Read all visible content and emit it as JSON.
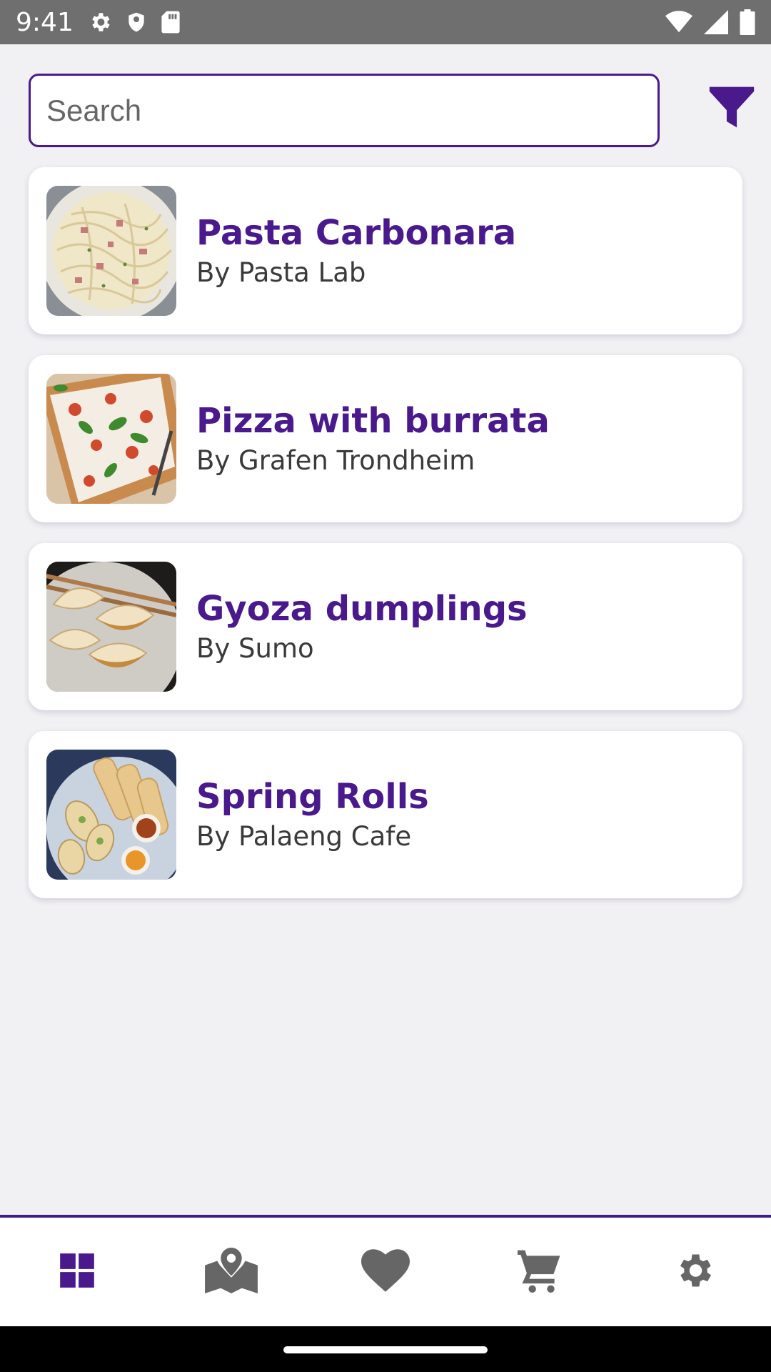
{
  "status_bar": {
    "time": "9:41",
    "left_icons": [
      "gear-icon",
      "shield-icon",
      "sd-card-icon"
    ],
    "right_icons": [
      "wifi-icon",
      "signal-icon",
      "battery-icon"
    ]
  },
  "search": {
    "placeholder": "Search",
    "value": ""
  },
  "filter_icon": "filter-icon",
  "colors": {
    "accent": "#4a1a8c",
    "background": "#f1f0f2",
    "nav_inactive": "#666666"
  },
  "restaurants": [
    {
      "title": "Pasta Carbonara",
      "subtitle": "By Pasta Lab",
      "image": "pasta-carbonara"
    },
    {
      "title": "Pizza with burrata",
      "subtitle": "By Grafen Trondheim",
      "image": "pizza-burrata"
    },
    {
      "title": "Gyoza dumplings",
      "subtitle": "By Sumo",
      "image": "gyoza-dumplings"
    },
    {
      "title": "Spring Rolls",
      "subtitle": "By Palaeng Cafe",
      "image": "spring-rolls"
    }
  ],
  "bottom_nav": [
    {
      "icon": "dashboard-icon",
      "active": true
    },
    {
      "icon": "map-icon",
      "active": false
    },
    {
      "icon": "heart-icon",
      "active": false
    },
    {
      "icon": "cart-icon",
      "active": false
    },
    {
      "icon": "gear-icon",
      "active": false
    }
  ]
}
